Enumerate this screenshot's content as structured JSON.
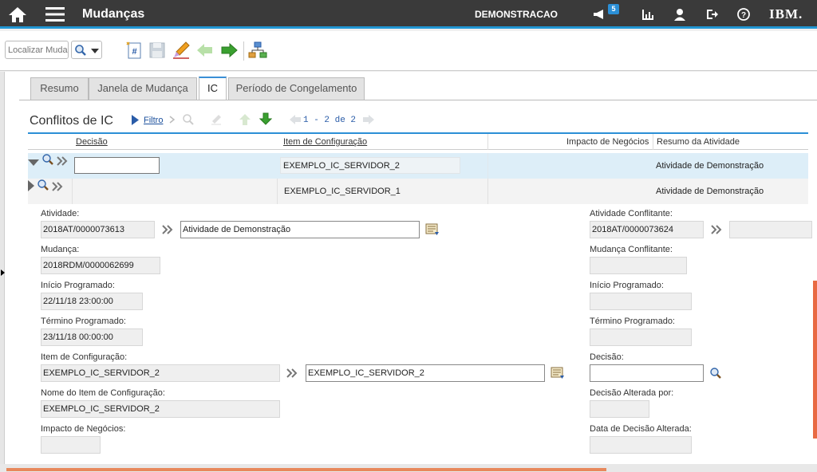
{
  "header": {
    "title": "Mudanças",
    "org": "DEMONSTRACAO",
    "notification_count": "5",
    "brand": "IBM."
  },
  "toolbar": {
    "search_placeholder": "Localizar Mudança"
  },
  "tabs": [
    {
      "label": "Resumo"
    },
    {
      "label": "Janela de Mudança"
    },
    {
      "label": "IC"
    },
    {
      "label": "Período de Congelamento"
    }
  ],
  "section": {
    "title": "Conflitos de IC",
    "filter_label": "Filtro",
    "pagination": "1 - 2 de 2"
  },
  "table": {
    "columns": [
      "Decisão",
      "Item de Configuração",
      "Impacto de Negócios",
      "Resumo da Atividade"
    ],
    "rows": [
      {
        "decision": "",
        "ci": "EXEMPLO_IC_SERVIDOR_2",
        "impact": "",
        "summary": "Atividade de Demonstração"
      },
      {
        "decision": "",
        "ci": "EXEMPLO_IC_SERVIDOR_1",
        "impact": "",
        "summary": "Atividade de Demonstração"
      }
    ]
  },
  "detail": {
    "atividade_label": "Atividade:",
    "atividade_value": "2018AT/0000073613",
    "atividade_desc": "Atividade de Demonstração",
    "mudanca_label": "Mudança:",
    "mudanca_value": "2018RDM/0000062699",
    "inicio_label": "Início Programado:",
    "inicio_value": "22/11/18 23:00:00",
    "termino_label": "Término Programado:",
    "termino_value": "23/11/18 00:00:00",
    "item_label": "Item de Configuração:",
    "item_value": "EXEMPLO_IC_SERVIDOR_2",
    "item_desc": "EXEMPLO_IC_SERVIDOR_2",
    "nome_label": "Nome do Item de Configuração:",
    "nome_value": "EXEMPLO_IC_SERVIDOR_2",
    "impacto_label": "Impacto de Negócios:",
    "impacto_value": "",
    "ativ_conf_label": "Atividade Conflitante:",
    "ativ_conf_value": "2018AT/0000073624",
    "ativ_conf_desc": "",
    "mud_conf_label": "Mudança Conflitante:",
    "mud_conf_value": "",
    "inicio2_label": "Início Programado:",
    "inicio2_value": "",
    "termino2_label": "Término Programado:",
    "termino2_value": "",
    "decisao_label": "Decisão:",
    "decisao_value": "",
    "decisao_alt_label": "Decisão Alterada por:",
    "decisao_alt_value": "",
    "data_dec_label": "Data de Decisão Alterada:",
    "data_dec_value": ""
  },
  "colors": {
    "topbar": "#3a3a3a",
    "accent": "#2b8fd6",
    "scroll": "#e86a43"
  }
}
